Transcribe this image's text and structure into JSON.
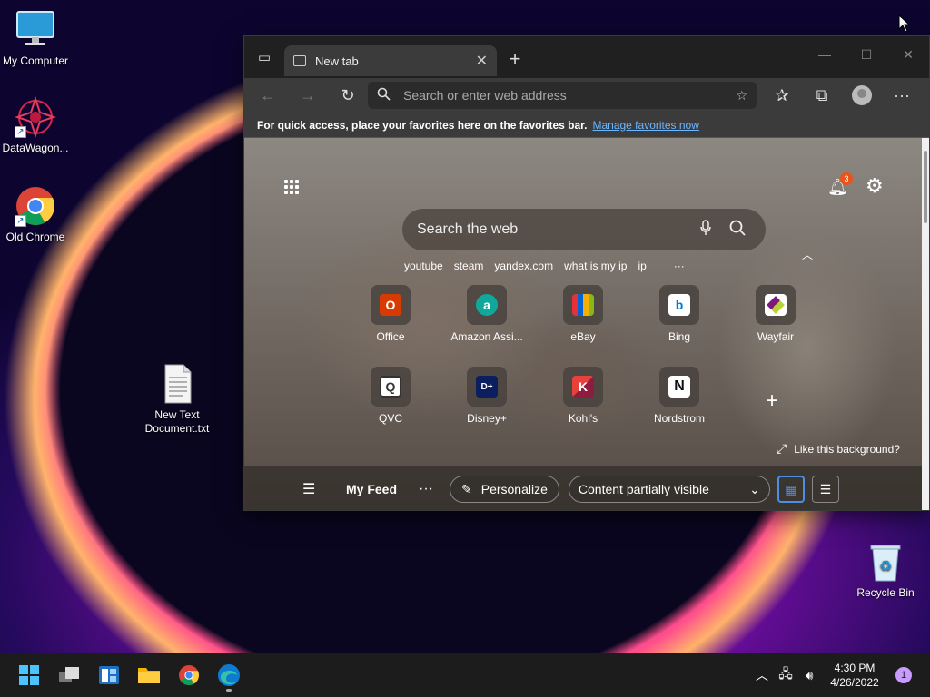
{
  "desktop": {
    "icons": [
      {
        "label": "My Computer"
      },
      {
        "label": "DataWagon..."
      },
      {
        "label": "Old Chrome"
      },
      {
        "label": "New Text Document.txt"
      },
      {
        "label": "Recycle Bin"
      }
    ]
  },
  "browser": {
    "tab_title": "New tab",
    "address_placeholder": "Search or enter web address",
    "favorites_bar": {
      "text": "For quick access, place your favorites here on the favorites bar.",
      "link": "Manage favorites now"
    },
    "ntp": {
      "search_placeholder": "Search the web",
      "notification_count": "3",
      "suggestions": [
        "youtube",
        "steam",
        "yandex.com",
        "what is my ip",
        "ip",
        "···"
      ],
      "tiles": [
        {
          "label": "Office",
          "color": "#d83b01",
          "glyph": "O"
        },
        {
          "label": "Amazon Assi...",
          "color": "#0fa89a",
          "glyph": "a"
        },
        {
          "label": "eBay",
          "color": "#e53238",
          "glyph": "▮"
        },
        {
          "label": "Bing",
          "color": "#0078d4",
          "glyph": "b"
        },
        {
          "label": "Wayfair",
          "color": "#7f187f",
          "glyph": "◆"
        },
        {
          "label": "QVC",
          "color": "#ffffff",
          "glyph": "Q"
        },
        {
          "label": "Disney+",
          "color": "#113ccf",
          "glyph": "D+"
        },
        {
          "label": "Kohl's",
          "color": "#8c1d40",
          "glyph": "K"
        },
        {
          "label": "Nordstrom",
          "color": "#ffffff",
          "glyph": "N"
        }
      ],
      "like_background": "Like this background?",
      "feed": {
        "title": "My Feed",
        "personalize": "Personalize",
        "content_visibility": "Content partially visible"
      }
    }
  },
  "taskbar": {
    "time": "4:30 PM",
    "date": "4/26/2022",
    "notification_count": "1"
  }
}
